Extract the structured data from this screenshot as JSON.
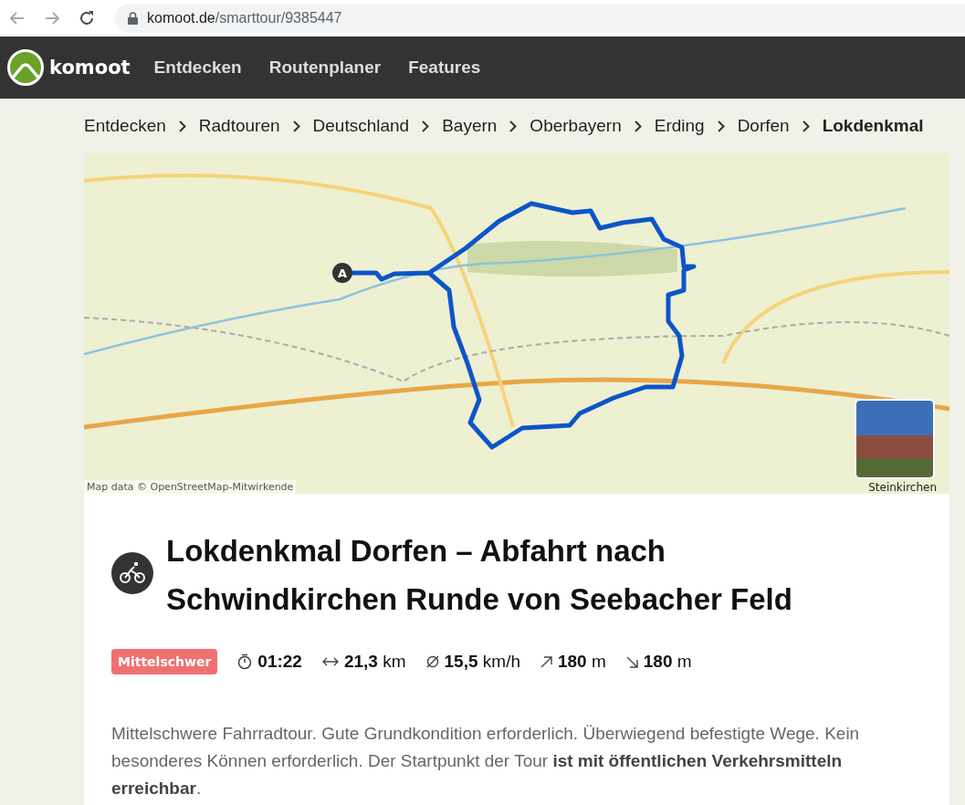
{
  "browser": {
    "url_host": "komoot.de",
    "url_path": "/smarttour/9385447"
  },
  "nav": {
    "logo": "komoot",
    "items": [
      {
        "label": "Entdecken"
      },
      {
        "label": "Routenplaner"
      },
      {
        "label": "Features"
      }
    ]
  },
  "breadcrumbs": [
    {
      "label": "Entdecken",
      "current": false
    },
    {
      "label": "Radtouren",
      "current": false
    },
    {
      "label": "Deutschland",
      "current": false
    },
    {
      "label": "Bayern",
      "current": false
    },
    {
      "label": "Oberbayern",
      "current": false
    },
    {
      "label": "Erding",
      "current": false
    },
    {
      "label": "Dorfen",
      "current": false
    },
    {
      "label": "Lokdenkmal",
      "current": true
    }
  ],
  "map": {
    "start_marker": "A",
    "attribution": "Map data © OpenStreetMap-Mitwirkende",
    "photo_caption": "Steinkirchen"
  },
  "tour": {
    "title": "Lokdenkmal Dorfen – Abfahrt nach Schwindkirchen Runde von Seebacher Feld",
    "difficulty": "Mittelschwer",
    "stats": [
      {
        "kind": "duration",
        "value": "01:22"
      },
      {
        "kind": "distance",
        "value": "21,3",
        "unit": "km"
      },
      {
        "kind": "speed",
        "value": "15,5",
        "unit": "km/h"
      },
      {
        "kind": "uphill",
        "value": "180",
        "unit": "m"
      },
      {
        "kind": "downhill",
        "value": "180",
        "unit": "m"
      }
    ],
    "description": "Mittelschwere Fahrradtour. Gute Grundkondition erforderlich. Überwiegend befestigte Wege. Kein besonderes Können erforderlich. Der Startpunkt der Tour **ist mit öffentlichen Verkehrsmitteln erreichbar**."
  }
}
